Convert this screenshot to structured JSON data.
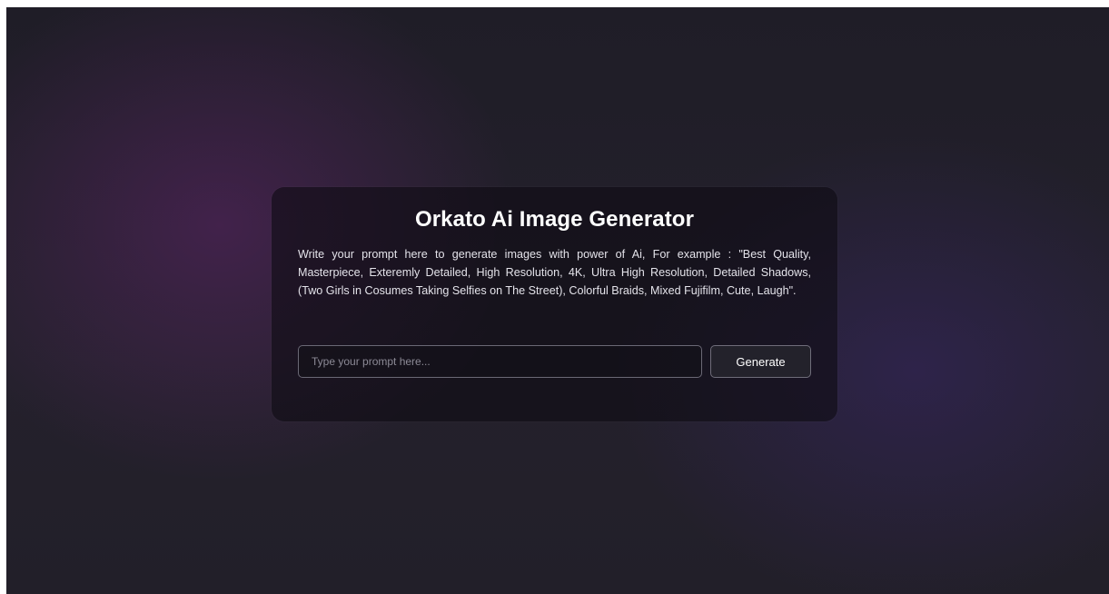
{
  "app": {
    "title": "Orkato Ai Image Generator",
    "description": "Write your prompt here to generate images with power of Ai, For example : \"Best Quality, Masterpiece, Exteremly Detailed, High Resolution, 4K, Ultra High Resolution, Detailed Shadows, (Two Girls in Cosumes Taking Selfies on The Street), Colorful Braids, Mixed Fujifilm, Cute, Laugh\"."
  },
  "prompt": {
    "value": "",
    "placeholder": "Type your prompt here..."
  },
  "actions": {
    "generate_label": "Generate"
  },
  "colors": {
    "background": "#22202b",
    "card": "#0e0c14",
    "accent_purple": "#5c2466",
    "accent_violet": "#3a266e",
    "text_primary": "#ffffff",
    "input_border": "#6a6875"
  }
}
